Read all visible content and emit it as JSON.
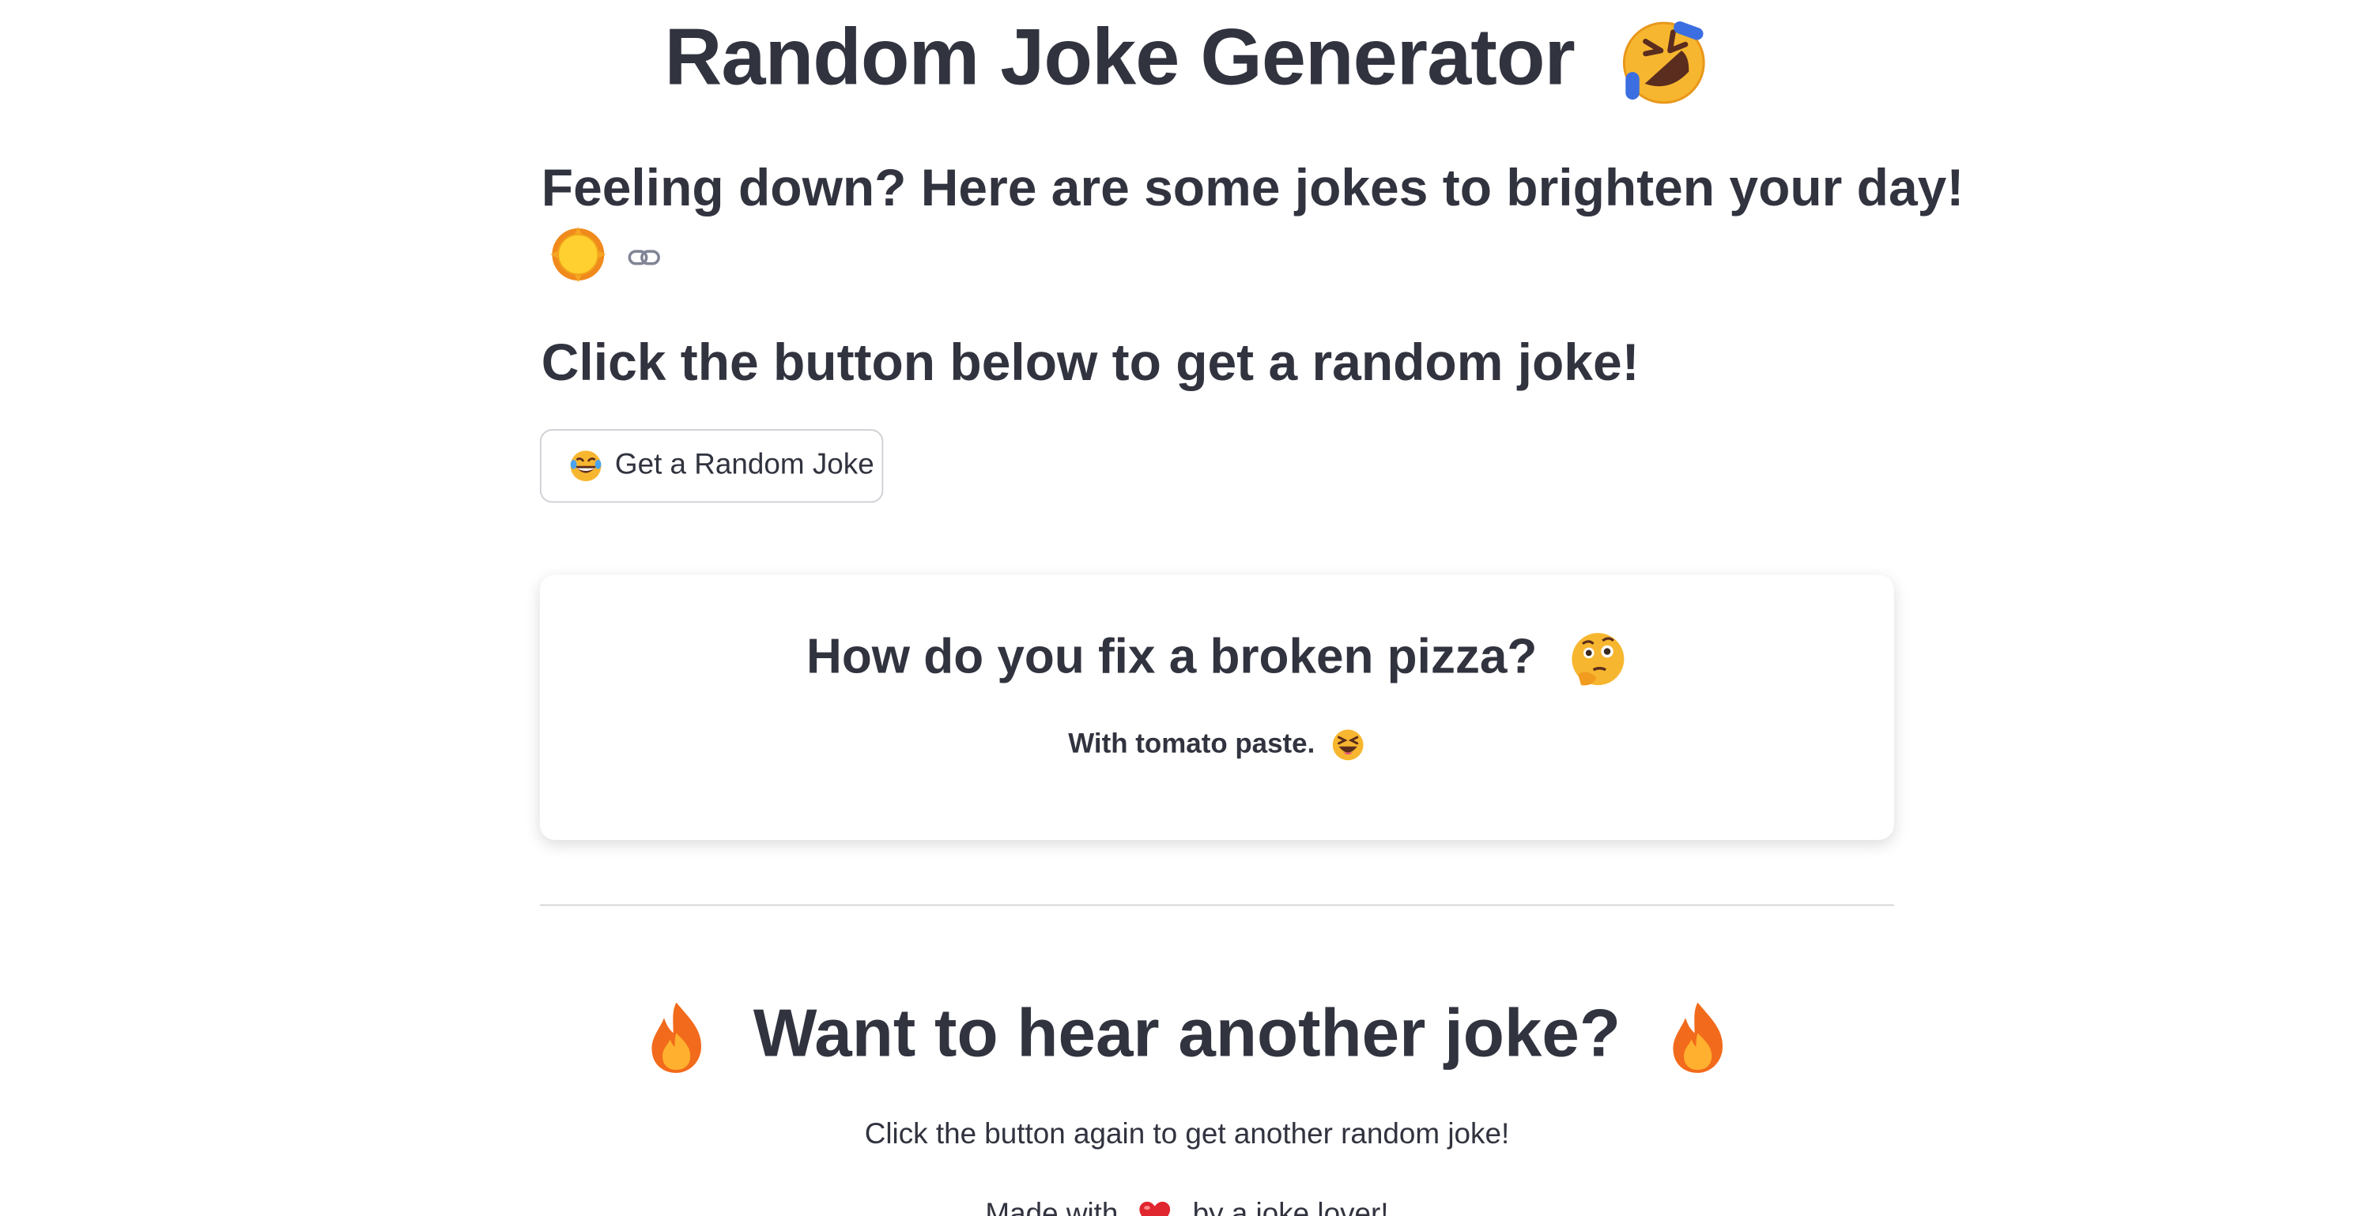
{
  "header": {
    "title": "Random Joke Generator",
    "title_icon": "rolling-on-floor-laughing-emoji"
  },
  "intro": {
    "heading": "Feeling down? Here are some jokes to brighten your day!",
    "sun_icon": "sun-emoji",
    "anchor_icon": "link-icon"
  },
  "instructions": {
    "heading": "Click the button below to get a random joke!"
  },
  "joke_button": {
    "label": "Get a Random Joke",
    "icon": "tears-of-joy-emoji"
  },
  "joke": {
    "setup": "How do you fix a broken pizza?",
    "setup_icon": "thinking-face-emoji",
    "punchline": "With tomato paste.",
    "punchline_icon": "squinting-laughing-emoji"
  },
  "another": {
    "heading": "Want to hear another joke?",
    "icon": "fire-emoji",
    "subtext": "Click the button again to get another random joke!"
  },
  "footer": {
    "prefix": "Made with",
    "heart_icon": "red-heart-emoji",
    "suffix": "by a joke lover!"
  },
  "colors": {
    "text": "#31333f",
    "divider": "#d6d6d9",
    "button_border": "#d0d1d6"
  }
}
